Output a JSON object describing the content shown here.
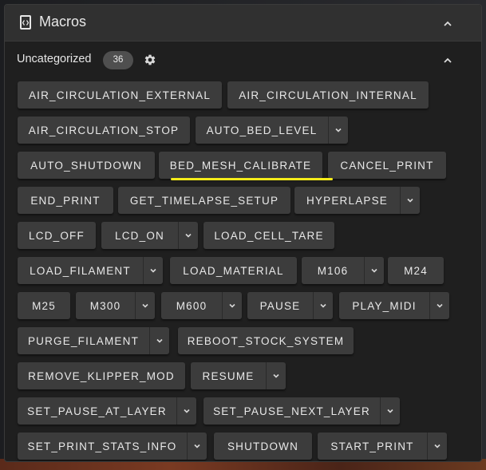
{
  "header": {
    "title": "Macros"
  },
  "section": {
    "label": "Uncategorized",
    "count": "36"
  },
  "macros": [
    {
      "label": "AIR_CIRCULATION_EXTERNAL",
      "has_menu": false
    },
    {
      "label": "AIR_CIRCULATION_INTERNAL",
      "has_menu": false
    },
    {
      "label": "AIR_CIRCULATION_STOP",
      "has_menu": false
    },
    {
      "label": "AUTO_BED_LEVEL",
      "has_menu": true
    },
    {
      "label": "AUTO_SHUTDOWN",
      "has_menu": false
    },
    {
      "label": "BED_MESH_CALIBRATE",
      "has_menu": false
    },
    {
      "label": "CANCEL_PRINT",
      "has_menu": false
    },
    {
      "label": "END_PRINT",
      "has_menu": false
    },
    {
      "label": "GET_TIMELAPSE_SETUP",
      "has_menu": false
    },
    {
      "label": "HYPERLAPSE",
      "has_menu": true
    },
    {
      "label": "LCD_OFF",
      "has_menu": false
    },
    {
      "label": "LCD_ON",
      "has_menu": true
    },
    {
      "label": "LOAD_CELL_TARE",
      "has_menu": false
    },
    {
      "label": "LOAD_FILAMENT",
      "has_menu": true
    },
    {
      "label": "LOAD_MATERIAL",
      "has_menu": false
    },
    {
      "label": "M106",
      "has_menu": true
    },
    {
      "label": "M24",
      "has_menu": false
    },
    {
      "label": "M25",
      "has_menu": false
    },
    {
      "label": "M300",
      "has_menu": true
    },
    {
      "label": "M600",
      "has_menu": true
    },
    {
      "label": "PAUSE",
      "has_menu": true
    },
    {
      "label": "PLAY_MIDI",
      "has_menu": true
    },
    {
      "label": "PURGE_FILAMENT",
      "has_menu": true
    },
    {
      "label": "REBOOT_STOCK_SYSTEM",
      "has_menu": false
    },
    {
      "label": "REMOVE_KLIPPER_MOD",
      "has_menu": false
    },
    {
      "label": "RESUME",
      "has_menu": true
    },
    {
      "label": "SET_PAUSE_AT_LAYER",
      "has_menu": true
    },
    {
      "label": "SET_PAUSE_NEXT_LAYER",
      "has_menu": true
    },
    {
      "label": "SET_PRINT_STATS_INFO",
      "has_menu": true
    },
    {
      "label": "SHUTDOWN",
      "has_menu": false
    },
    {
      "label": "START_PRINT",
      "has_menu": true
    }
  ],
  "icons": {
    "header": "macro-file-icon",
    "collapse": "chevron-up-icon",
    "settings": "gear-icon",
    "menu": "chevron-down-icon"
  },
  "colors": {
    "highlight_underline": "#f5ec1a",
    "button_bg": "#3c3c3c",
    "panel_bg": "#1f1f1f",
    "header_bg": "#303030"
  }
}
